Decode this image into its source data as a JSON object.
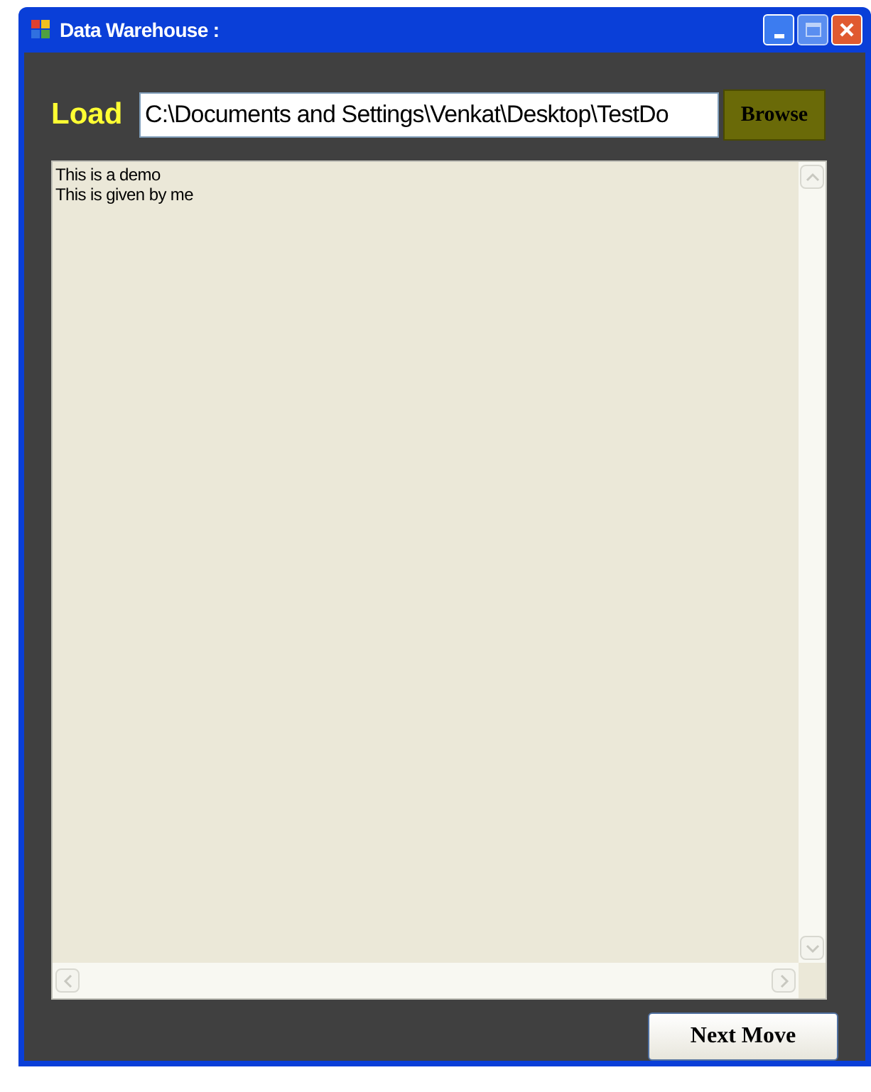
{
  "window": {
    "title": "Data Warehouse :"
  },
  "load": {
    "label": "Load",
    "path": "C:\\Documents and Settings\\Venkat\\Desktop\\TestDo",
    "button": "Browse"
  },
  "content": {
    "lines": [
      "This is a demo",
      "This is given by me"
    ]
  },
  "buttons": [
    "Next Move"
  ]
}
